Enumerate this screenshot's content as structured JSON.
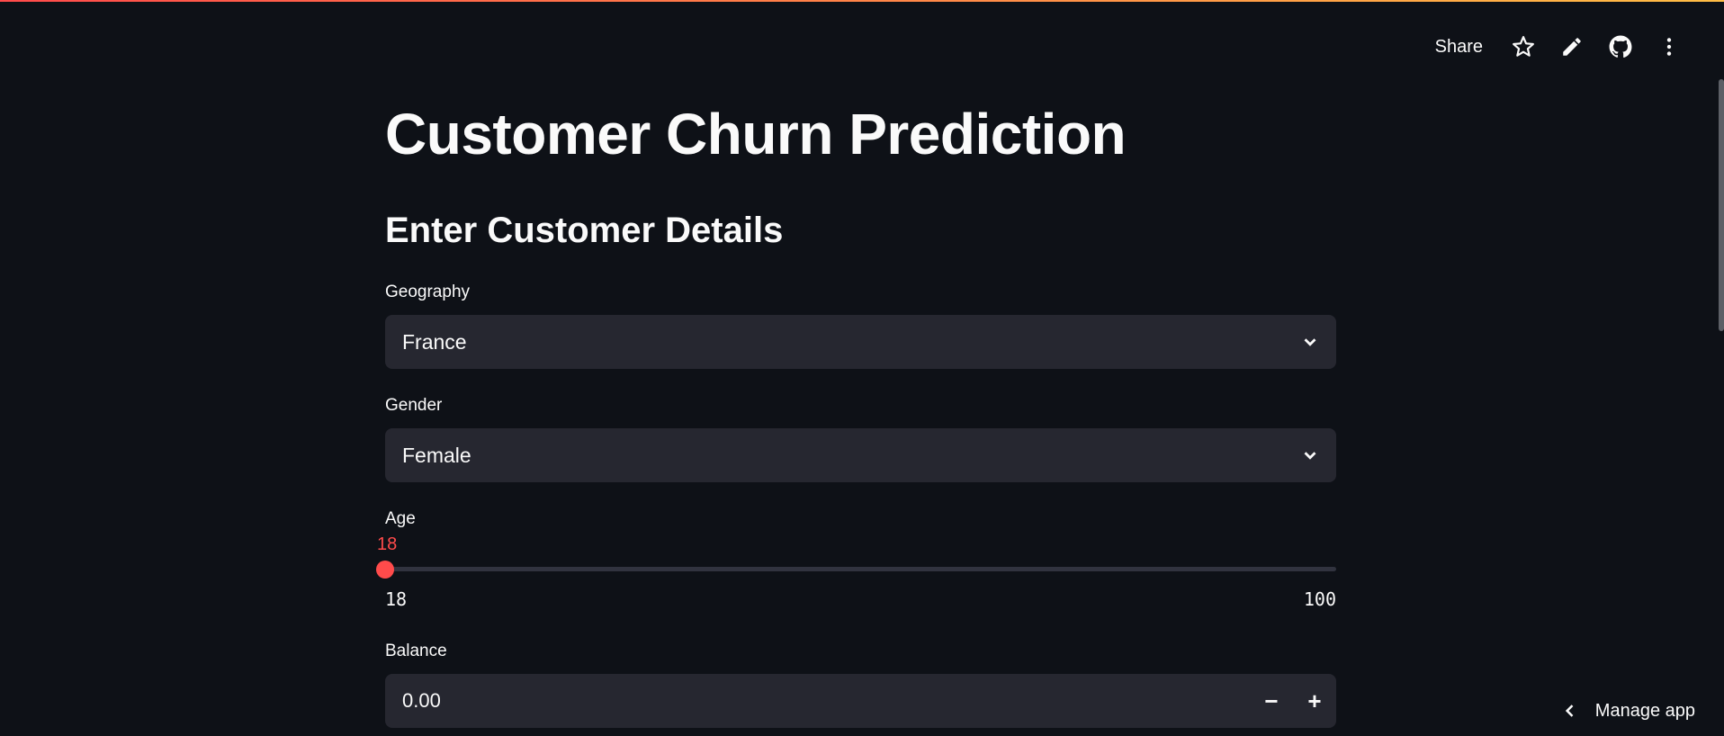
{
  "header": {
    "share_label": "Share",
    "icons": [
      "star-icon",
      "edit-icon",
      "github-icon",
      "more-vertical-icon"
    ]
  },
  "page": {
    "title": "Customer Churn Prediction",
    "subtitle": "Enter Customer Details"
  },
  "form": {
    "geography": {
      "label": "Geography",
      "value": "France"
    },
    "gender": {
      "label": "Gender",
      "value": "Female"
    },
    "age": {
      "label": "Age",
      "value": "18",
      "min": "18",
      "max": "100"
    },
    "balance": {
      "label": "Balance",
      "value": "0.00",
      "decrement": "−",
      "increment": "+"
    }
  },
  "footer": {
    "manage_app_label": "Manage app"
  },
  "colors": {
    "accent": "#ff4b4b",
    "background": "#0e1117",
    "input_bg": "#262730"
  }
}
